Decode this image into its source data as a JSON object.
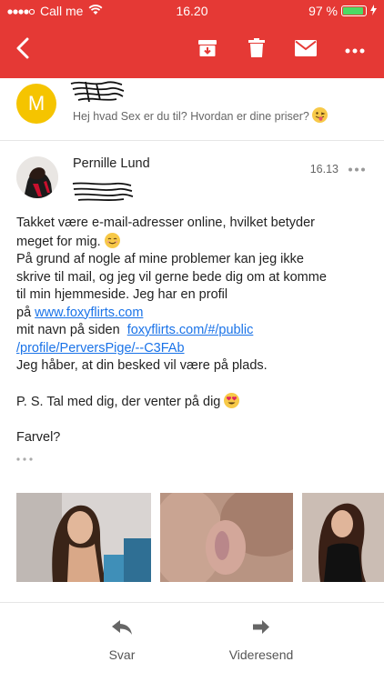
{
  "status_bar": {
    "carrier": "Call me",
    "time": "16.20",
    "battery_percent": "97 %",
    "battery_level": 0.97
  },
  "toolbar": {
    "back_icon": "back-arrow-icon",
    "archive_icon": "archive-icon",
    "delete_icon": "trash-icon",
    "mark_icon": "envelope-icon",
    "more_icon": "more-dots-icon"
  },
  "previous_message": {
    "avatar_letter": "M",
    "snippet": "Hej hvad Sex er du til? Hvordan er dine priser?"
  },
  "message": {
    "sender": "Pernille Lund",
    "time": "16.13",
    "body": {
      "line1": "Takket være e-mail-adresser online, hvilket betyder",
      "line2": "meget for mig.",
      "line3": "På grund af nogle af mine problemer kan jeg ikke",
      "line4": "skrive til mail, og jeg vil gerne bede dig om at komme",
      "line5": "til min hjemmeside. Jeg har en profil",
      "line6_prefix": "på ",
      "link1": "www.foxyflirts.com",
      "line7_prefix": "mit navn på siden  ",
      "link2a": "foxyflirts.com/#/public",
      "link2b": "/profile/PerversPige/--C3FAb",
      "line8": "Jeg håber, at din besked vil være på plads.",
      "ps": "P. S. Tal med dig, der venter på dig",
      "signoff": "Farvel?"
    }
  },
  "actions": {
    "reply": "Svar",
    "forward": "Videresend"
  },
  "colors": {
    "header_red": "#e53935",
    "link_blue": "#1a73e8",
    "avatar_yellow": "#f5c400"
  }
}
